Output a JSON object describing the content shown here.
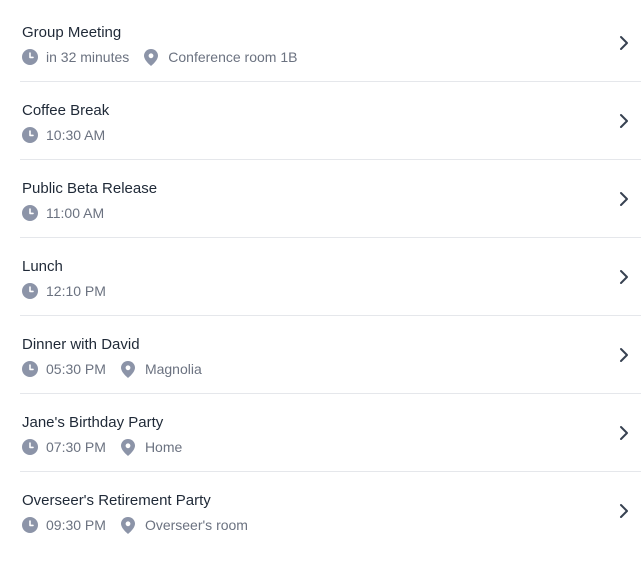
{
  "colors": {
    "title": "#1f2937",
    "meta_text": "#6b7280",
    "icon": "#8c94a8",
    "divider": "#e5e7eb",
    "chevron": "#374151"
  },
  "events": [
    {
      "title": "Group Meeting",
      "time": "in 32 minutes",
      "location": "Conference room 1B"
    },
    {
      "title": "Coffee Break",
      "time": "10:30 AM",
      "location": ""
    },
    {
      "title": "Public Beta Release",
      "time": "11:00 AM",
      "location": ""
    },
    {
      "title": "Lunch",
      "time": "12:10 PM",
      "location": ""
    },
    {
      "title": "Dinner with David",
      "time": "05:30 PM",
      "location": "Magnolia"
    },
    {
      "title": "Jane's Birthday Party",
      "time": "07:30 PM",
      "location": "Home"
    },
    {
      "title": "Overseer's Retirement Party",
      "time": "09:30 PM",
      "location": "Overseer's room"
    }
  ],
  "icons": {
    "time": "clock-icon",
    "location": "map-pin-icon",
    "open": "chevron-right-icon"
  }
}
